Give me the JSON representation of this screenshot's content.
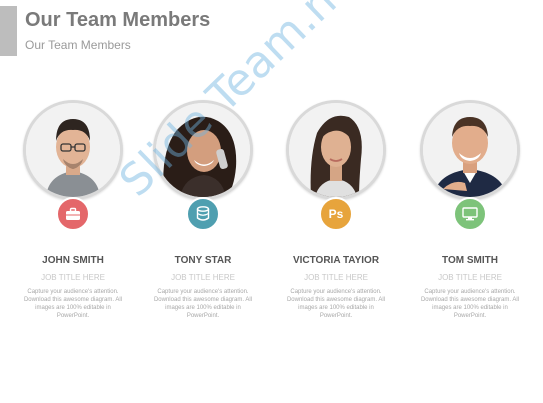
{
  "header": {
    "title": "Our Team Members",
    "subtitle": "Our Team Members"
  },
  "members": [
    {
      "name": "JOHN SMITH",
      "job_title": "JOB TITLE HERE",
      "description": "Capture your audience's attention. Download this awesome diagram. All images are 100% editable in PowerPoint.",
      "icon": "briefcase-icon",
      "badge_color": "#e4676a",
      "badge_text": ""
    },
    {
      "name": "TONY STAR",
      "job_title": "JOB TITLE HERE",
      "description": "Capture your audience's attention. Download this awesome diagram. All images are 100% editable in PowerPoint.",
      "icon": "database-icon",
      "badge_color": "#4f9fb0",
      "badge_text": ""
    },
    {
      "name": "VICTORIA TAYIOR",
      "job_title": "JOB TITLE HERE",
      "description": "Capture your audience's attention. Download this awesome diagram. All images are 100% editable in PowerPoint.",
      "icon": "photoshop-icon",
      "badge_color": "#e7a43c",
      "badge_text": "Ps"
    },
    {
      "name": "TOM SMITH",
      "job_title": "JOB TITLE HERE",
      "description": "Capture your audience's attention. Download this awesome diagram. All images are 100% editable in PowerPoint.",
      "icon": "monitor-icon",
      "badge_color": "#7dc37a",
      "badge_text": ""
    }
  ],
  "watermark": {
    "text": "Slide Team.net"
  }
}
